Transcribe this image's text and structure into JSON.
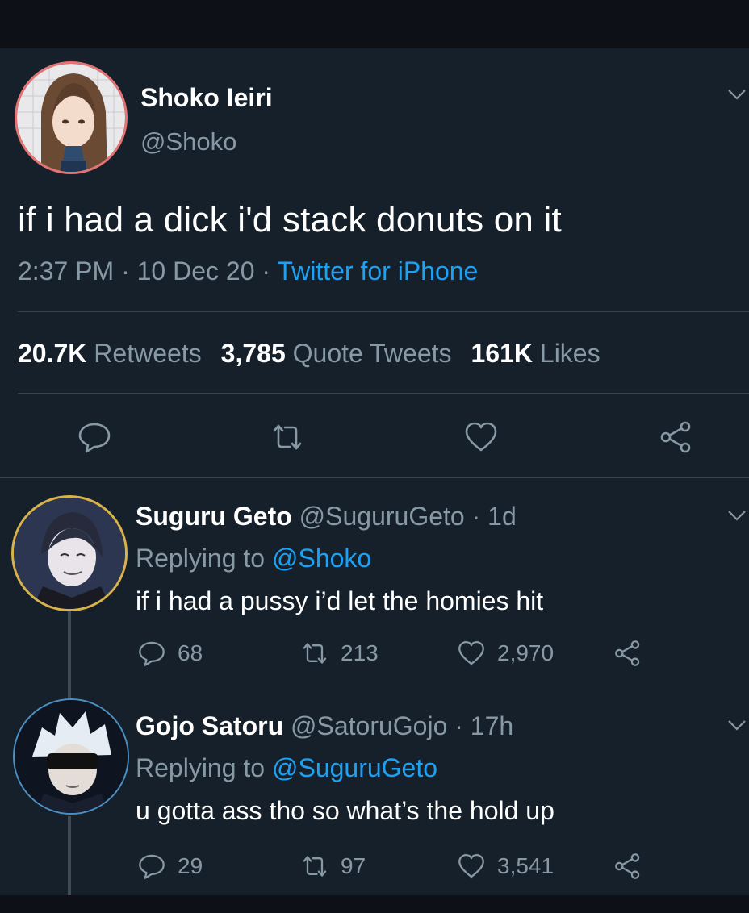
{
  "main_tweet": {
    "name": "Shoko Ieiri",
    "handle": "@Shoko",
    "text": "if i had a dick i'd stack donuts on it",
    "time": "2:37 PM",
    "date": "10 Dec 20",
    "source": "Twitter for iPhone",
    "retweets": "20.7K",
    "retweets_label": "Retweets",
    "quotes": "3,785",
    "quotes_label": "Quote Tweets",
    "likes": "161K",
    "likes_label": "Likes"
  },
  "replies": [
    {
      "name": "Suguru Geto",
      "handle": "@SuguruGeto",
      "age": "1d",
      "replying_label": "Replying to",
      "replying_to": "@Shoko",
      "text": "if i had a pussy i’d let the homies hit",
      "replies": "68",
      "retweets": "213",
      "likes": "2,970"
    },
    {
      "name": "Gojo Satoru",
      "handle": "@SatoruGojo",
      "age": "17h",
      "replying_label": "Replying to",
      "replying_to": "@SuguruGeto",
      "text": "u gotta ass tho so what’s the hold up",
      "replies": "29",
      "retweets": "97",
      "likes": "3,541"
    }
  ],
  "colors": {
    "background": "#15202b",
    "accent": "#1da1f2",
    "secondary_text": "#8899a6",
    "separator": "#38444d"
  },
  "icons": [
    "chevron-down-icon",
    "reply-icon",
    "retweet-icon",
    "like-icon",
    "share-icon"
  ]
}
